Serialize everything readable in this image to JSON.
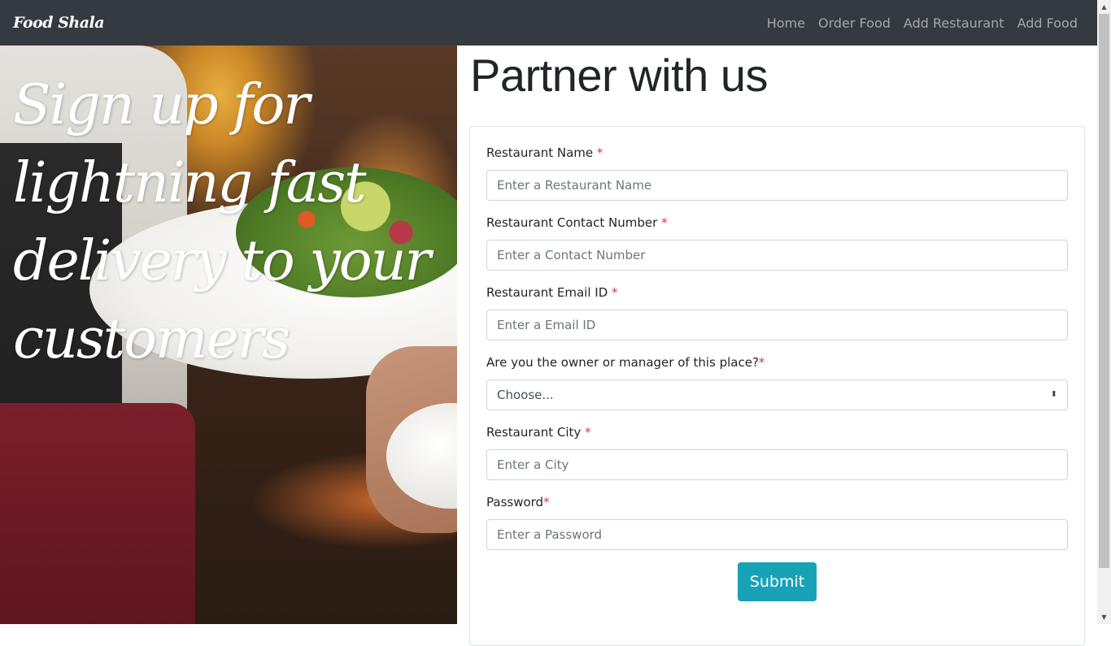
{
  "navbar": {
    "brand": "Food Shala",
    "links": [
      "Home",
      "Order Food",
      "Add Restaurant",
      "Add Food"
    ]
  },
  "hero": {
    "title": "Sign up for lightning fast delivery to your customers"
  },
  "page": {
    "title": "Partner with us"
  },
  "form": {
    "required_mark": "*",
    "fields": [
      {
        "label": "Restaurant Name",
        "placeholder": "Enter a Restaurant Name"
      },
      {
        "label": "Restaurant Contact Number",
        "placeholder": "Enter a Contact Number"
      },
      {
        "label": "Restaurant Email ID",
        "placeholder": "Enter a Email ID"
      }
    ],
    "owner_select": {
      "label": "Are you the owner or manager of this place?",
      "selected": "Choose...",
      "arrow_icon": "⬍"
    },
    "city": {
      "label": "Restaurant City",
      "placeholder": "Enter a City"
    },
    "password": {
      "label": "Password",
      "placeholder": "Enter a Password"
    },
    "submit_label": "Submit"
  },
  "colors": {
    "navbar_bg": "#343a40",
    "submit_bg": "#17a2b8",
    "required": "#dc3545"
  },
  "scrollbar": {
    "up_icon": "▲",
    "down_icon": "▼"
  }
}
